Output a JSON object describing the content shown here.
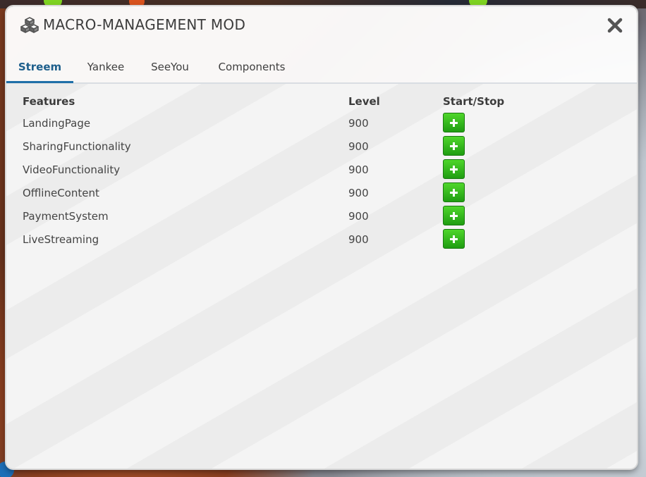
{
  "window": {
    "title": "MACRO-MANAGEMENT MOD",
    "title_icon": "cubes-icon",
    "close_icon": "close-icon"
  },
  "tabs": [
    {
      "label": "Streem",
      "active": true
    },
    {
      "label": "Yankee",
      "active": false
    },
    {
      "label": "SeeYou",
      "active": false
    },
    {
      "label": "Components",
      "active": false
    }
  ],
  "table": {
    "headers": {
      "features": "Features",
      "level": "Level",
      "action": "Start/Stop"
    },
    "rows": [
      {
        "feature": "LandingPage",
        "level": "900",
        "action_icon": "plus-icon"
      },
      {
        "feature": "SharingFunctionality",
        "level": "900",
        "action_icon": "plus-icon"
      },
      {
        "feature": "VideoFunctionality",
        "level": "900",
        "action_icon": "plus-icon"
      },
      {
        "feature": "OfflineContent",
        "level": "900",
        "action_icon": "plus-icon"
      },
      {
        "feature": "PaymentSystem",
        "level": "900",
        "action_icon": "plus-icon"
      },
      {
        "feature": "LiveStreaming",
        "level": "900",
        "action_icon": "plus-icon"
      }
    ]
  },
  "colors": {
    "accent": "#1e6fa8",
    "start_button": "#2bb51a"
  }
}
